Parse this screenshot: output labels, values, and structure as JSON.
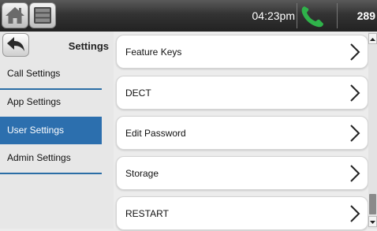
{
  "status": {
    "time": "04:23pm",
    "extension": "289"
  },
  "sidebar": {
    "title": "Settings",
    "items": [
      {
        "label": "Call Settings",
        "active": false
      },
      {
        "label": "App Settings",
        "active": false
      },
      {
        "label": "User Settings",
        "active": true
      },
      {
        "label": "Admin Settings",
        "active": false
      }
    ]
  },
  "list": {
    "items": [
      {
        "label": "Feature Keys"
      },
      {
        "label": "DECT"
      },
      {
        "label": "Edit Password"
      },
      {
        "label": "Storage"
      },
      {
        "label": "RESTART"
      }
    ]
  },
  "colors": {
    "accent": "#2c6fae",
    "call_green": "#2fb24a"
  }
}
